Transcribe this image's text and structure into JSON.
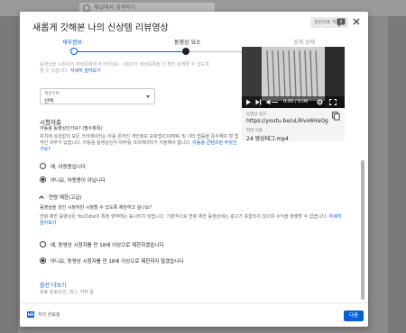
{
  "background": {
    "search_placeholder": "채널에서 검색하기"
  },
  "dialog": {
    "title": "새롭게 갓해본 나의 신상템 리뷰영상",
    "save_status": "초안으로 저장됨"
  },
  "steps": [
    {
      "label": "세부정보",
      "state": "active"
    },
    {
      "label": "동영상 요소",
      "state": "done"
    },
    {
      "label": "공개 상태",
      "state": "pending"
    }
  ],
  "top_faint": {
    "line1": "동영상을 시청자의 재생목록에 추가하세요. 시청자가 재생목록을 더 빨리 검색할 수 있도록",
    "line2": "할 수 있습니다.",
    "learn_more": "자세히 알아보기"
  },
  "playlist": {
    "caption": "재생목록",
    "value": "선택"
  },
  "audience": {
    "heading": "시청자층",
    "subheading": "아동용 동영상인가요? (필수항목)",
    "desc": "위치에 상관없이 모든 크리에이터는 아동 온라인 개인정보 보호법(COPPA) 및 기타 법률을 준수해야 할 법적인 의무가 있습니다. 아동용 동영상인지 여부를 크리에이터가 지정해야 합니다.",
    "desc_link": "아동용 콘텐츠란 무엇인가요?",
    "options": [
      {
        "label": "예, 아동용입니다",
        "selected": false
      },
      {
        "label": "아니요, 아동용이 아닙니다",
        "selected": true
      }
    ]
  },
  "age_restriction": {
    "toggle_label": "연령 제한(고급)",
    "question": "동영상을 성인 시청자만 시청할 수 있도록 제한하고 싶나요?",
    "desc": "연령 제한 동영상은 YouTube의 특정 영역에는 표시되지 않습니다. 기본적으로 연령 제한 동영상에는 광고가 포함되지 않으며 수익을 창출할 수 없습니다.",
    "desc_link": "자세히 알아보기",
    "options": [
      {
        "label": "예, 동영상 시청자를 만 18세 이상으로 제한하겠습니다",
        "selected": false
      },
      {
        "label": "아니요, 동영상 시청자를 만 18세 이상으로 제한하지 않겠습니다",
        "selected": true
      }
    ]
  },
  "more_options": {
    "label": "옵션 더보기",
    "desc": "유료 프로모션, 태그, 자막 등"
  },
  "preview": {
    "time": "0:00 / 0:06",
    "link_label": "동영상 링크",
    "link_value": "https://youtu.be/uLRivo6HaOg",
    "file_label": "파일 이름",
    "file_value": "24 영상태그.mp4"
  },
  "footer": {
    "badge": "HD",
    "status": "처리 완료됨",
    "next": "다음"
  },
  "colors": {
    "accent": "#065fd4",
    "done": "#202020"
  }
}
